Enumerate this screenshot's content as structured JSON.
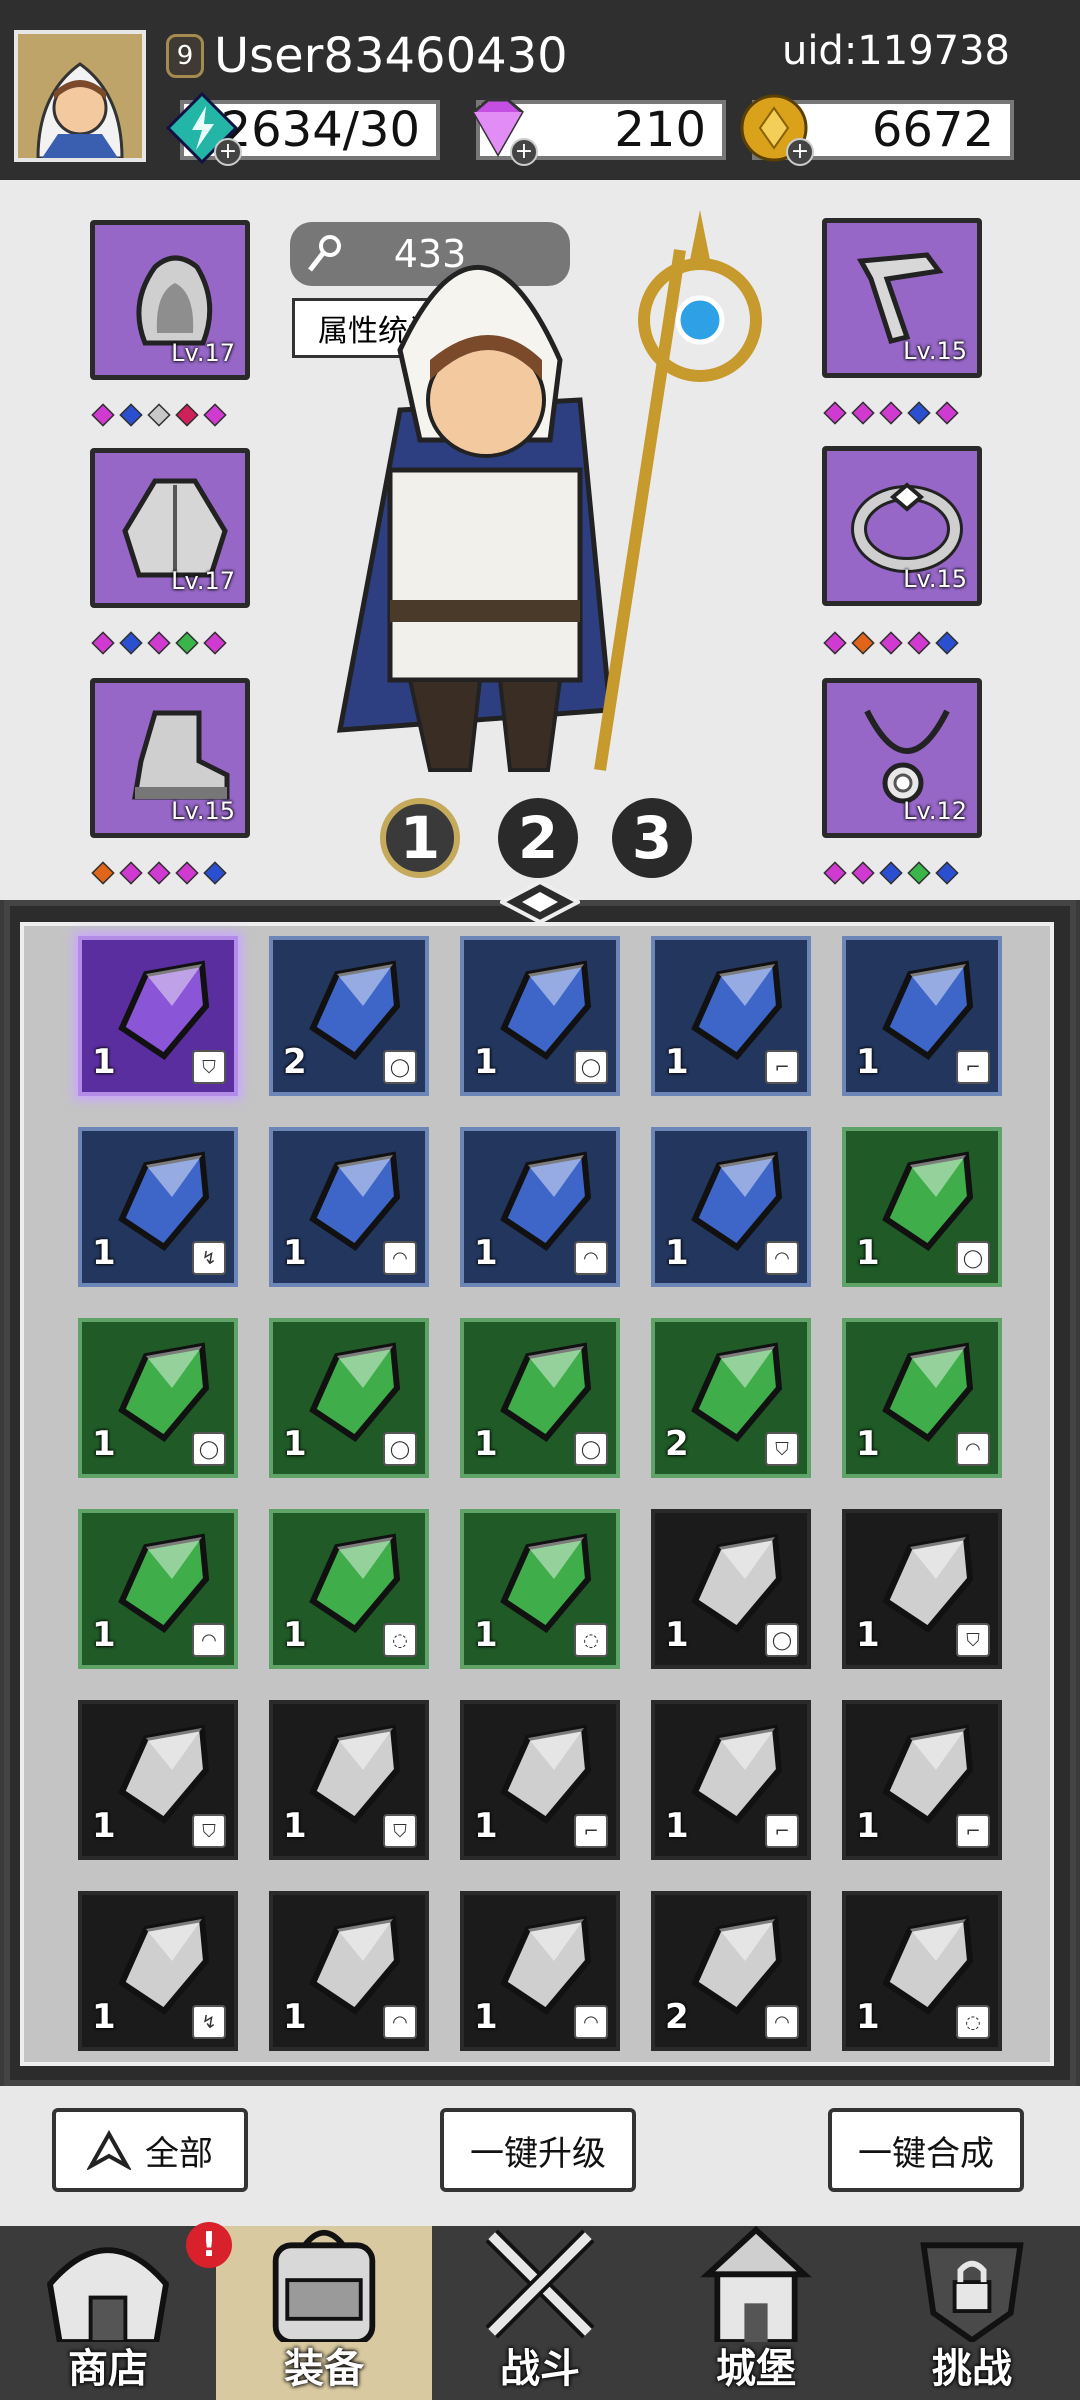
{
  "header": {
    "level": "9",
    "username": "User83460430",
    "uid": "uid:119738",
    "resources": [
      {
        "name": "energy",
        "value": "2634/30",
        "icon": "lightning-crystal-icon",
        "color": "#23b5a5"
      },
      {
        "name": "diamond",
        "value": "210",
        "icon": "purple-diamond-icon",
        "color": "#c64fe3"
      },
      {
        "name": "gold",
        "value": "6672",
        "icon": "gold-coin-icon",
        "color": "#d9a21a"
      }
    ]
  },
  "hero": {
    "power": "433",
    "stats_button": "属性统计",
    "pages": [
      "1",
      "2",
      "3"
    ],
    "active_page": 0
  },
  "equipment": {
    "left": [
      {
        "slot": "helmet",
        "icon": "hood-helmet-icon",
        "level": "Lv.17",
        "gems": [
          "#d03ad0",
          "#2a4fd1",
          "#c8c8c8",
          "#d0205a",
          "#d03ad0"
        ]
      },
      {
        "slot": "armor",
        "icon": "cloak-armor-icon",
        "level": "Lv.17",
        "gems": [
          "#d03ad0",
          "#2a4fd1",
          "#d03ad0",
          "#39b54a",
          "#d03ad0"
        ]
      },
      {
        "slot": "boots",
        "icon": "boot-icon",
        "level": "Lv.15",
        "gems": [
          "#e0641a",
          "#d03ad0",
          "#d03ad0",
          "#d03ad0",
          "#2a4fd1"
        ]
      }
    ],
    "right": [
      {
        "slot": "weapon",
        "icon": "wand-icon",
        "level": "Lv.15",
        "gems": [
          "#d03ad0",
          "#d03ad0",
          "#d03ad0",
          "#2a4fd1",
          "#d03ad0"
        ]
      },
      {
        "slot": "ring",
        "icon": "ring-icon",
        "level": "Lv.15",
        "gems": [
          "#d03ad0",
          "#e0641a",
          "#d03ad0",
          "#d03ad0",
          "#2a4fd1"
        ]
      },
      {
        "slot": "necklace",
        "icon": "necklace-icon",
        "level": "Lv.12",
        "gems": [
          "#d03ad0",
          "#d03ad0",
          "#2a4fd1",
          "#39b54a",
          "#2a4fd1"
        ]
      }
    ]
  },
  "inventory": {
    "rarity_colors": {
      "purple": "#5b2ea0",
      "blue": "#23365e",
      "green": "#1f5a27",
      "gray": "#1b1b1b"
    },
    "items": [
      {
        "rarity": "purple",
        "count": "1",
        "tag": "cloak"
      },
      {
        "rarity": "blue",
        "count": "2",
        "tag": "ring"
      },
      {
        "rarity": "blue",
        "count": "1",
        "tag": "ring"
      },
      {
        "rarity": "blue",
        "count": "1",
        "tag": "boot"
      },
      {
        "rarity": "blue",
        "count": "1",
        "tag": "boot"
      },
      {
        "rarity": "blue",
        "count": "1",
        "tag": "wand"
      },
      {
        "rarity": "blue",
        "count": "1",
        "tag": "hood"
      },
      {
        "rarity": "blue",
        "count": "1",
        "tag": "hood"
      },
      {
        "rarity": "blue",
        "count": "1",
        "tag": "hood"
      },
      {
        "rarity": "green",
        "count": "1",
        "tag": "ring"
      },
      {
        "rarity": "green",
        "count": "1",
        "tag": "ring"
      },
      {
        "rarity": "green",
        "count": "1",
        "tag": "ring"
      },
      {
        "rarity": "green",
        "count": "1",
        "tag": "ring"
      },
      {
        "rarity": "green",
        "count": "2",
        "tag": "cloak"
      },
      {
        "rarity": "green",
        "count": "1",
        "tag": "hood"
      },
      {
        "rarity": "green",
        "count": "1",
        "tag": "hood"
      },
      {
        "rarity": "green",
        "count": "1",
        "tag": "necklace"
      },
      {
        "rarity": "green",
        "count": "1",
        "tag": "necklace"
      },
      {
        "rarity": "gray",
        "count": "1",
        "tag": "ring"
      },
      {
        "rarity": "gray",
        "count": "1",
        "tag": "cloak"
      },
      {
        "rarity": "gray",
        "count": "1",
        "tag": "cloak"
      },
      {
        "rarity": "gray",
        "count": "1",
        "tag": "cloak"
      },
      {
        "rarity": "gray",
        "count": "1",
        "tag": "boot"
      },
      {
        "rarity": "gray",
        "count": "1",
        "tag": "boot"
      },
      {
        "rarity": "gray",
        "count": "1",
        "tag": "boot"
      },
      {
        "rarity": "gray",
        "count": "1",
        "tag": "wand"
      },
      {
        "rarity": "gray",
        "count": "1",
        "tag": "hood"
      },
      {
        "rarity": "gray",
        "count": "1",
        "tag": "hood"
      },
      {
        "rarity": "gray",
        "count": "2",
        "tag": "hood"
      },
      {
        "rarity": "gray",
        "count": "1",
        "tag": "necklace"
      }
    ]
  },
  "controls": {
    "filter_label": "全部",
    "upgrade_all_label": "一键升级",
    "merge_all_label": "一键合成"
  },
  "nav": {
    "items": [
      {
        "label": "商店",
        "icon": "shop-icon"
      },
      {
        "label": "装备",
        "icon": "backpack-icon"
      },
      {
        "label": "战斗",
        "icon": "crossed-swords-icon"
      },
      {
        "label": "城堡",
        "icon": "castle-icon"
      },
      {
        "label": "挑战",
        "icon": "locked-shield-icon"
      }
    ],
    "active_index": 1,
    "alert_badge": "!"
  }
}
